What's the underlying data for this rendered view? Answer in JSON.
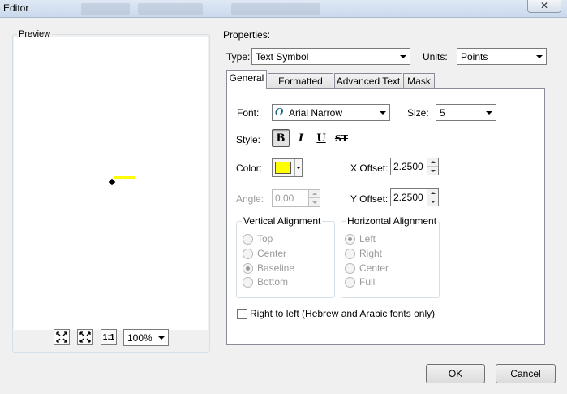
{
  "window": {
    "title": "Editor",
    "close_glyph": "✕"
  },
  "preview": {
    "group_label": "Preview",
    "zoom_value": "100%",
    "zoom_fit_icon": "zoom-to-fit-icon",
    "zoom_full_icon": "full-extent-icon",
    "zoom_actual_label": "1:1",
    "sample_color": "#ffff00"
  },
  "properties": {
    "group_label": "Properties:",
    "type_label": "Type:",
    "type_value": "Text Symbol",
    "units_label": "Units:",
    "units_value": "Points"
  },
  "tabs": [
    {
      "label": "General"
    },
    {
      "label": "Formatted Text"
    },
    {
      "label": "Advanced Text"
    },
    {
      "label": "Mask"
    }
  ],
  "general": {
    "font_label": "Font:",
    "font_value": "Arial Narrow",
    "font_icon": "opentype-font-icon",
    "size_label": "Size:",
    "size_value": "5",
    "style_label": "Style:",
    "style_buttons": [
      {
        "label": "B"
      },
      {
        "label": "I"
      },
      {
        "label": "U"
      },
      {
        "label": "ST"
      }
    ],
    "color_label": "Color:",
    "color_value": "#ffff00",
    "x_offset_label": "X Offset:",
    "x_offset_value": "2.2500",
    "angle_label": "Angle:",
    "angle_value": "0.00",
    "y_offset_label": "Y Offset:",
    "y_offset_value": "2.2500",
    "vertical_alignment": {
      "label": "Vertical Alignment",
      "options": [
        "Top",
        "Center",
        "Baseline",
        "Bottom"
      ],
      "selected": "Baseline"
    },
    "horizontal_alignment": {
      "label": "Horizontal Alignment",
      "options": [
        "Left",
        "Right",
        "Center",
        "Full"
      ],
      "selected": "Left"
    },
    "rtl_label": "Right to left (Hebrew and Arabic fonts only)"
  },
  "buttons": {
    "ok": "OK",
    "cancel": "Cancel"
  }
}
